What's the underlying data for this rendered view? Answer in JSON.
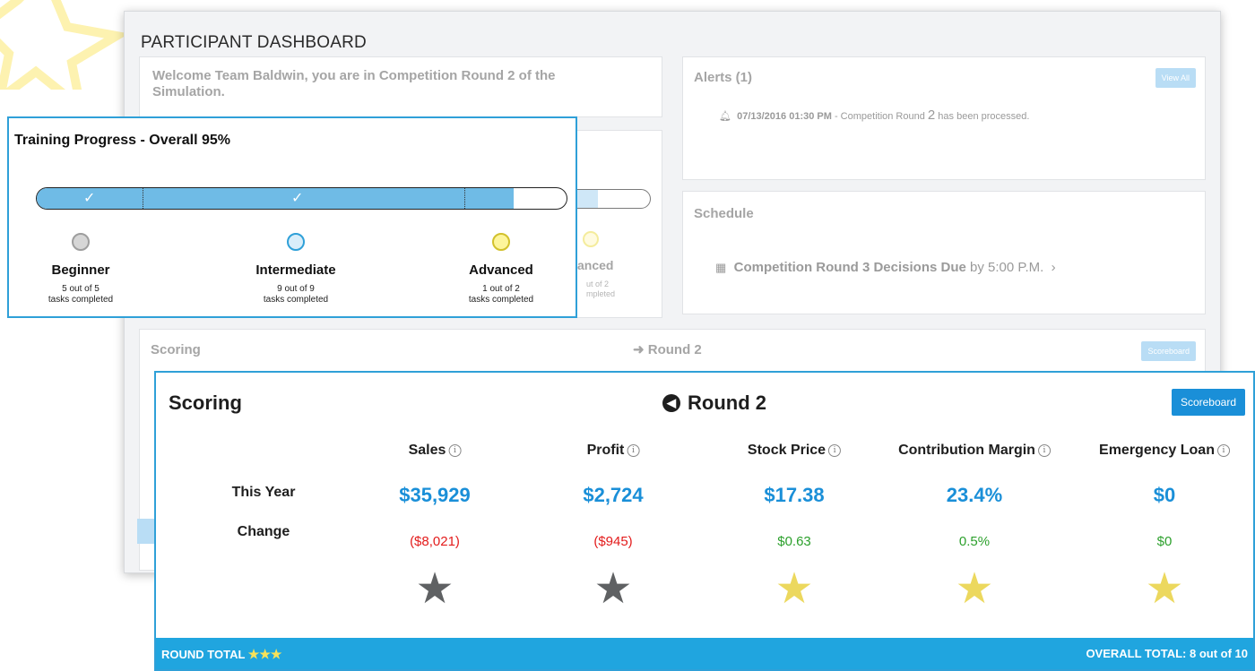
{
  "dashboard": {
    "title": "PARTICIPANT DASHBOARD",
    "welcome": "Welcome Team Baldwin, you are in Competition Round 2 of the Simulation.",
    "alerts": {
      "header": "Alerts (1)",
      "view_all": "View All",
      "items": [
        {
          "timestamp": "07/13/2016 01:30 PM",
          "text_pre": " - Competition Round ",
          "round": "2",
          "text_post": " has been processed."
        }
      ]
    },
    "training_bg": {
      "partial_label": "anced",
      "partial_count": "ut of 2",
      "partial_tasks": "mpleted"
    },
    "schedule": {
      "header": "Schedule",
      "item_bold": "Competition Round 3 Decisions Due",
      "item_rest": " by 5:00 P.M.",
      "chevron": "›"
    },
    "scoring_bg": {
      "header": "Scoring",
      "round": "Round 2",
      "button": "Scoreboard"
    }
  },
  "training": {
    "title": "Training Progress - Overall 95%",
    "progress": 0.9,
    "stages": [
      {
        "name": "Beginner",
        "count": "5 out of 5",
        "tasks": "tasks completed",
        "color": "#9e9e9e",
        "fill": "#d6d6d6"
      },
      {
        "name": "Intermediate",
        "count": "9 out of 9",
        "tasks": "tasks completed",
        "color": "#2fa0d8",
        "fill": "#d9eefa"
      },
      {
        "name": "Advanced",
        "count": "1 out of 2",
        "tasks": "tasks completed",
        "color": "#d2c12c",
        "fill": "#fdf59b"
      }
    ]
  },
  "scoring": {
    "title": "Scoring",
    "round": "Round 2",
    "button": "Scoreboard",
    "row_this_year": "This Year",
    "row_change": "Change",
    "columns": [
      {
        "name": "Sales",
        "this_year": "$35,929",
        "change": "($8,021)",
        "change_dir": "neg",
        "star": "gray"
      },
      {
        "name": "Profit",
        "this_year": "$2,724",
        "change": "($945)",
        "change_dir": "neg",
        "star": "gray"
      },
      {
        "name": "Stock Price",
        "this_year": "$17.38",
        "change": "$0.63",
        "change_dir": "pos",
        "star": "gold"
      },
      {
        "name": "Contribution Margin",
        "this_year": "23.4%",
        "change": "0.5%",
        "change_dir": "pos",
        "star": "gold"
      },
      {
        "name": "Emergency Loan",
        "this_year": "$0",
        "change": "$0",
        "change_dir": "pos",
        "star": "gold"
      }
    ],
    "round_total_label": "ROUND TOTAL",
    "round_total_stars": "★★★",
    "overall_total": "OVERALL TOTAL: 8 out of 10"
  }
}
